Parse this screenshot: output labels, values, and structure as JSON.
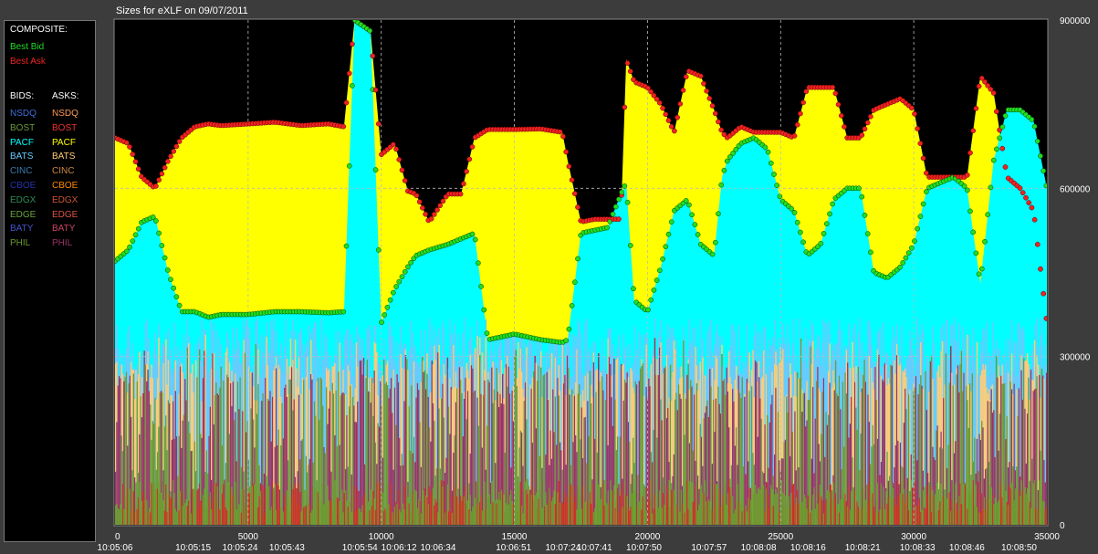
{
  "title": "Sizes for  eXLF  on  09/07/2011",
  "legend": {
    "composite_header": "COMPOSITE:",
    "best_bid": {
      "label": "Best Bid",
      "color": "#22dd22"
    },
    "best_ask": {
      "label": "Best Ask",
      "color": "#ee2222"
    },
    "bids_header": "BIDS:",
    "asks_header": "ASKS:",
    "bids": [
      {
        "label": "NSDQ",
        "color": "#3f6fd8"
      },
      {
        "label": "BOST",
        "color": "#6a9a3a"
      },
      {
        "label": "PACF",
        "color": "#00ffff"
      },
      {
        "label": "BATS",
        "color": "#66ccff"
      },
      {
        "label": "CINC",
        "color": "#3a7ab0"
      },
      {
        "label": "CBOE",
        "color": "#2233aa"
      },
      {
        "label": "EDGX",
        "color": "#2e8b57"
      },
      {
        "label": "EDGE",
        "color": "#6ba33a"
      },
      {
        "label": "BATY",
        "color": "#4455cc"
      },
      {
        "label": "PHIL",
        "color": "#6b9a2a"
      }
    ],
    "asks": [
      {
        "label": "NSDQ",
        "color": "#ff9955"
      },
      {
        "label": "BOST",
        "color": "#ee3333"
      },
      {
        "label": "PACF",
        "color": "#ffff00"
      },
      {
        "label": "BATS",
        "color": "#ffcc77"
      },
      {
        "label": "CINC",
        "color": "#cc8844"
      },
      {
        "label": "CBOE",
        "color": "#ff8800"
      },
      {
        "label": "EDGX",
        "color": "#cc5533"
      },
      {
        "label": "EDGE",
        "color": "#dd5544"
      },
      {
        "label": "BATY",
        "color": "#cc4466"
      },
      {
        "label": "PHIL",
        "color": "#993366"
      }
    ]
  },
  "chart_data": {
    "type": "area",
    "title": "Sizes for  eXLF  on  09/07/2011",
    "xlim": [
      0,
      35000
    ],
    "ylim": [
      0,
      900000
    ],
    "x_ticks": [
      "0",
      "5000",
      "10000",
      "15000",
      "20000",
      "25000",
      "30000",
      "35000"
    ],
    "x_tick_values": [
      0,
      5000,
      10000,
      15000,
      20000,
      25000,
      30000,
      35000
    ],
    "y_ticks": [
      "0",
      "300000",
      "600000",
      "900000"
    ],
    "y_tick_values": [
      0,
      300000,
      600000,
      900000
    ],
    "time_labels": [
      {
        "x": 0,
        "label": "10:05:06"
      },
      {
        "x": 2934,
        "label": "10:05:15"
      },
      {
        "x": 4696,
        "label": "10:05:24"
      },
      {
        "x": 6458,
        "label": "10:05:43"
      },
      {
        "x": 9196,
        "label": "10:05:54"
      },
      {
        "x": 10665,
        "label": "10:06:12"
      },
      {
        "x": 12133,
        "label": "10:06:34"
      },
      {
        "x": 14971,
        "label": "10:06:51"
      },
      {
        "x": 16831,
        "label": "10:07:24"
      },
      {
        "x": 18005,
        "label": "10:07:41"
      },
      {
        "x": 19865,
        "label": "10:07:50"
      },
      {
        "x": 22311,
        "label": "10:07:57"
      },
      {
        "x": 24171,
        "label": "10:08:08"
      },
      {
        "x": 26030,
        "label": "10:08:16"
      },
      {
        "x": 28083,
        "label": "10:08:21"
      },
      {
        "x": 30138,
        "label": "10:08:33"
      },
      {
        "x": 31996,
        "label": "10:08:46"
      },
      {
        "x": 33954,
        "label": "10:08:50"
      }
    ],
    "grid": true,
    "x": [
      0,
      500,
      1000,
      1500,
      2000,
      2500,
      3000,
      3500,
      4000,
      5000,
      6000,
      7000,
      8000,
      8600,
      9000,
      9600,
      10000,
      10500,
      11000,
      11300,
      11800,
      12500,
      13000,
      13500,
      14000,
      15000,
      16000,
      16800,
      17000,
      17500,
      18000,
      18500,
      19000,
      19200,
      19500,
      20000,
      20500,
      21000,
      21500,
      22000,
      22500,
      22800,
      23000,
      23500,
      24000,
      24500,
      25000,
      25500,
      26000,
      26500,
      27000,
      27500,
      28000,
      28500,
      29000,
      29500,
      30000,
      30500,
      31000,
      31500,
      32000,
      32500,
      33000,
      33500,
      34000,
      34500,
      35000
    ],
    "series": [
      {
        "name": "Best Ask",
        "values": [
          690000,
          680000,
          620000,
          600000,
          650000,
          690000,
          710000,
          715000,
          712000,
          715000,
          718000,
          712000,
          715000,
          710000,
          900000,
          880000,
          660000,
          680000,
          595000,
          590000,
          540000,
          590000,
          590000,
          690000,
          705000,
          705000,
          706000,
          700000,
          650000,
          540000,
          545000,
          545000,
          545000,
          830000,
          790000,
          780000,
          750000,
          700000,
          810000,
          800000,
          740000,
          700000,
          690000,
          710000,
          700000,
          700000,
          700000,
          690000,
          780000,
          780000,
          780000,
          690000,
          690000,
          740000,
          750000,
          760000,
          740000,
          620000,
          620000,
          620000,
          620000,
          800000,
          770000,
          620000,
          600000,
          560000,
          360000
        ]
      },
      {
        "name": "Best Bid",
        "values": [
          470000,
          490000,
          540000,
          550000,
          450000,
          380000,
          380000,
          370000,
          375000,
          375000,
          380000,
          380000,
          378000,
          380000,
          900000,
          880000,
          360000,
          420000,
          460000,
          480000,
          490000,
          500000,
          510000,
          520000,
          330000,
          340000,
          330000,
          325000,
          330000,
          520000,
          525000,
          530000,
          590000,
          610000,
          400000,
          380000,
          460000,
          560000,
          580000,
          500000,
          480000,
          620000,
          650000,
          680000,
          690000,
          670000,
          580000,
          560000,
          480000,
          500000,
          580000,
          600000,
          600000,
          450000,
          440000,
          460000,
          500000,
          600000,
          610000,
          620000,
          600000,
          430000,
          650000,
          740000,
          740000,
          720000,
          600000
        ]
      }
    ]
  }
}
